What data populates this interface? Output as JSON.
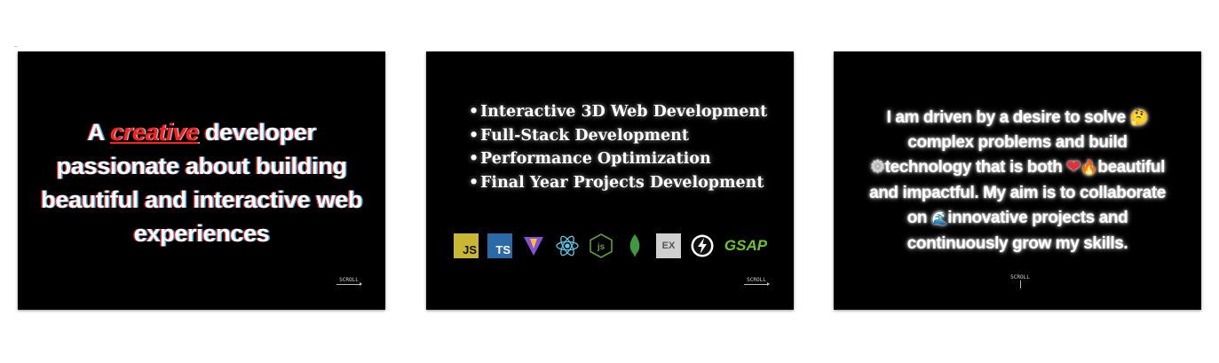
{
  "cards": [
    {
      "headline_prefix": "A ",
      "headline_highlight": "creative",
      "headline_line1_rest": " developer",
      "headline_line2": "passionate about building",
      "headline_line3": "beautiful and interactive web",
      "headline_line4": "experiences",
      "scroll_label": "SCROLL"
    },
    {
      "services": [
        "Interactive 3D Web Development",
        "Full-Stack Development",
        "Performance Optimization",
        "Final Year Projects Development"
      ],
      "bullet": "•",
      "tech_icons": [
        {
          "name": "javascript-icon",
          "label": "JS"
        },
        {
          "name": "typescript-icon",
          "label": "TS"
        },
        {
          "name": "vite-icon",
          "label": ""
        },
        {
          "name": "react-icon",
          "label": ""
        },
        {
          "name": "nodejs-icon",
          "label": ""
        },
        {
          "name": "mongodb-icon",
          "label": ""
        },
        {
          "name": "express-icon",
          "label": "EX"
        },
        {
          "name": "socketio-icon",
          "label": ""
        },
        {
          "name": "gsap-icon",
          "label": "GSAP"
        }
      ],
      "scroll_label": "SCROLL"
    },
    {
      "line1": "I am driven by a desire to solve ",
      "line2": "complex problems and build",
      "line3_a": "technology that is both ",
      "line3_b": "beautiful",
      "line4": "and impactful. My aim is to collaborate",
      "line5_a": "on ",
      "line5_b": "innovative projects and",
      "line6": "continuously grow my skills.",
      "emoji_thinker": "🤔",
      "emoji_gear": "⚙",
      "emoji_heart": "❤",
      "emoji_fire": "🔥",
      "emoji_wave": "🌊",
      "scroll_label": "SCROLL"
    }
  ],
  "colors": {
    "card_bg": "#000000",
    "page_bg": "#ffffff",
    "highlight": "#ff1e1e",
    "gsap_green": "#6bc62b",
    "js_yellow": "#c9b731",
    "ts_blue": "#2b6aa8"
  }
}
